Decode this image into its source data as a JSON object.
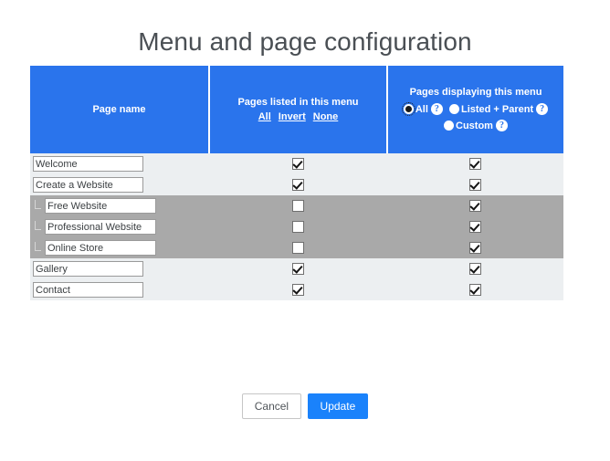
{
  "page": {
    "title": "Menu and page configuration"
  },
  "table": {
    "columns": [
      {
        "id": "page-name",
        "title": "Page name"
      },
      {
        "id": "pages-listed",
        "title": "Pages listed in this menu"
      },
      {
        "id": "pages-displaying",
        "title": "Pages displaying this menu"
      }
    ],
    "bulk_links": [
      {
        "id": "all",
        "label": "All"
      },
      {
        "id": "invert",
        "label": "Invert"
      },
      {
        "id": "none",
        "label": "None"
      }
    ],
    "display_mode": {
      "selected": "All",
      "options": [
        {
          "id": "all",
          "label": "All",
          "checked": true,
          "help": "?"
        },
        {
          "id": "listed-parent",
          "label": "Listed + Parent",
          "checked": false,
          "help": "?"
        },
        {
          "id": "custom",
          "label": "Custom",
          "checked": false,
          "help": "?"
        }
      ]
    },
    "rows": [
      {
        "name": "Welcome",
        "indented": false,
        "shaded": false,
        "listed": true,
        "displaying": true
      },
      {
        "name": "Create a Website",
        "indented": false,
        "shaded": false,
        "listed": true,
        "displaying": true
      },
      {
        "name": "Free Website",
        "indented": true,
        "shaded": true,
        "listed": false,
        "displaying": true
      },
      {
        "name": "Professional Website",
        "indented": true,
        "shaded": true,
        "listed": false,
        "displaying": true
      },
      {
        "name": "Online Store",
        "indented": true,
        "shaded": true,
        "listed": false,
        "displaying": true
      },
      {
        "name": "Gallery",
        "indented": false,
        "shaded": false,
        "listed": true,
        "displaying": true
      },
      {
        "name": "Contact",
        "indented": false,
        "shaded": false,
        "listed": true,
        "displaying": true
      }
    ]
  },
  "footer": {
    "cancel_label": "Cancel",
    "update_label": "Update"
  },
  "colors": {
    "header_blue": "#2a74ec",
    "row_light": "#eceff1",
    "row_shaded": "#a9a9a9",
    "update_button": "#1a82fb",
    "title_text": "#4a4f54"
  }
}
